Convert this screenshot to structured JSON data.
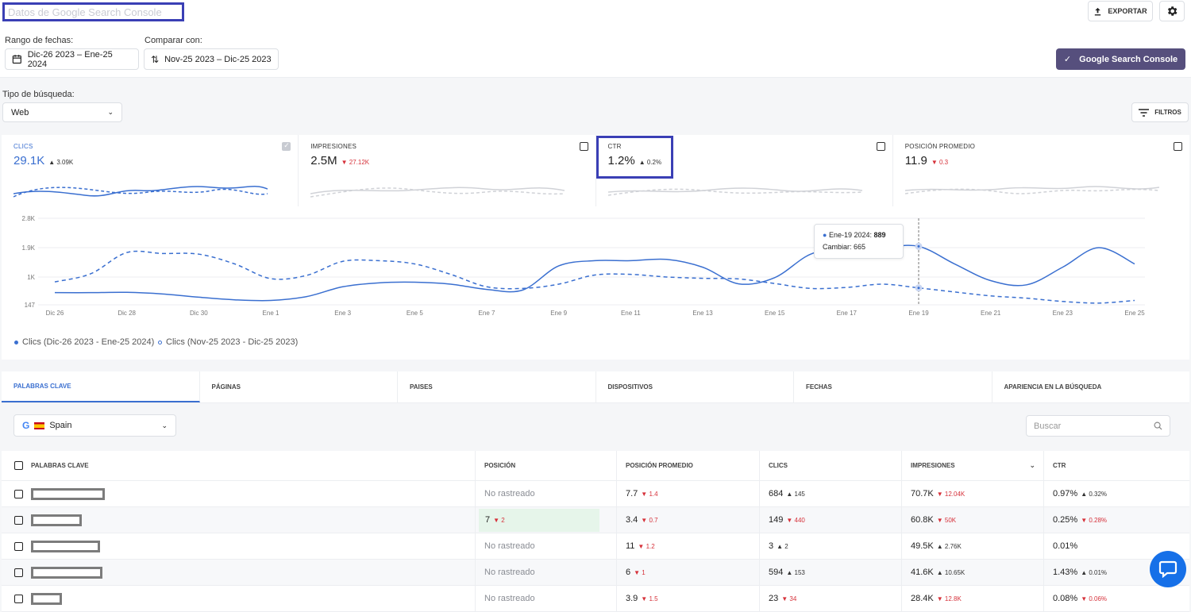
{
  "header": {
    "title": "Datos de Google Search Console",
    "export_label": "EXPORTAR",
    "icons": {
      "export": "upload-icon",
      "settings": "gear-icon"
    }
  },
  "dates": {
    "range_label": "Rango de fechas:",
    "range_value": "Dic-26 2023 – Ene-25 2024",
    "compare_label": "Comparar con:",
    "compare_value": "Nov-25 2023 – Dic-25 2023",
    "gsc_button": "Google Search Console"
  },
  "search_type": {
    "label": "Tipo de búsqueda:",
    "value": "Web",
    "filters_label": "FILTROS"
  },
  "metrics": [
    {
      "name": "CLICS",
      "value": "29.1K",
      "delta": "3.09K",
      "dir": "up",
      "checked": true
    },
    {
      "name": "IMPRESIONES",
      "value": "2.5M",
      "delta": "27.12K",
      "dir": "down",
      "checked": false
    },
    {
      "name": "CTR",
      "value": "1.2%",
      "delta": "0.2%",
      "dir": "up",
      "checked": false
    },
    {
      "name": "POSICIÓN PROMEDIO",
      "value": "11.9",
      "delta": "0.3",
      "dir": "down",
      "checked": false
    }
  ],
  "chart_data": {
    "type": "line",
    "x": [
      "Dic 26",
      "Dic 27",
      "Dic 28",
      "Dic 29",
      "Dic 30",
      "Dic 31",
      "Ene 1",
      "Ene 2",
      "Ene 3",
      "Ene 4",
      "Ene 5",
      "Ene 6",
      "Ene 7",
      "Ene 8",
      "Ene 9",
      "Ene 10",
      "Ene 11",
      "Ene 12",
      "Ene 13",
      "Ene 14",
      "Ene 15",
      "Ene 16",
      "Ene 17",
      "Ene 18",
      "Ene 19",
      "Ene 20",
      "Ene 21",
      "Ene 22",
      "Ene 23",
      "Ene 24",
      "Ene 25"
    ],
    "x_tick_labels": [
      "Dic 26",
      "Dic 28",
      "Dic 30",
      "Ene 1",
      "Ene 3",
      "Ene 5",
      "Ene 7",
      "Ene 9",
      "Ene 11",
      "Ene 13",
      "Ene 15",
      "Ene 17",
      "Ene 19",
      "Ene 21",
      "Ene 23",
      "Ene 25"
    ],
    "y_tick_labels": [
      "2.8K",
      "1.9K",
      "1K",
      "147"
    ],
    "ylim": [
      147,
      2800
    ],
    "series": [
      {
        "name": "Clics (Dic-26 2023 - Ene-25 2024)",
        "style": "solid",
        "values": [
          520,
          520,
          530,
          480,
          380,
          300,
          280,
          400,
          700,
          820,
          840,
          780,
          620,
          600,
          1340,
          1500,
          1500,
          1540,
          1300,
          790,
          980,
          1700,
          1880,
          1900,
          1940,
          1400,
          889,
          760,
          1300,
          1900,
          1400
        ]
      },
      {
        "name": "Clics (Nov-25 2023 - Dic-25 2023)",
        "style": "dashed",
        "values": [
          850,
          1100,
          1750,
          1720,
          1700,
          1400,
          950,
          1050,
          1480,
          1500,
          1400,
          1080,
          700,
          650,
          780,
          1060,
          1080,
          1000,
          960,
          940,
          800,
          650,
          680,
          780,
          665,
          540,
          420,
          350,
          250,
          200,
          280
        ]
      }
    ],
    "tooltip": {
      "label": "Ene-19 2024:",
      "value": "889",
      "compare_label": "Cambiar:",
      "compare_value": "665"
    }
  },
  "tabs": [
    "PALABRAS CLAVE",
    "PÁGINAS",
    "PAISES",
    "DISPOSITIVOS",
    "FECHAS",
    "APARIENCIA EN LA BÚSQUEDA"
  ],
  "country": {
    "value": "Spain"
  },
  "search": {
    "placeholder": "Buscar"
  },
  "table": {
    "headers": [
      "PALABRAS CLAVE",
      "POSICIÓN",
      "POSICIÓN PROMEDIO",
      "CLICS",
      "IMPRESIONES",
      "CTR"
    ],
    "rows": [
      {
        "position": "No rastreado",
        "avg": "7.7",
        "avg_d": "1.4",
        "avg_dir": "down",
        "clics": "684",
        "clics_d": "145",
        "clics_dir": "up",
        "impr": "70.7K",
        "impr_d": "12.04K",
        "impr_dir": "down",
        "ctr": "0.97%",
        "ctr_d": "0.32%",
        "ctr_dir": "up"
      },
      {
        "position": "7",
        "pos_d": "2",
        "avg": "3.4",
        "avg_d": "0.7",
        "avg_dir": "down",
        "clics": "149",
        "clics_d": "440",
        "clics_dir": "down",
        "impr": "60.8K",
        "impr_d": "50K",
        "impr_dir": "down",
        "ctr": "0.25%",
        "ctr_d": "0.28%",
        "ctr_dir": "down"
      },
      {
        "position": "No rastreado",
        "avg": "11",
        "avg_d": "1.2",
        "avg_dir": "down",
        "clics": "3",
        "clics_d": "2",
        "clics_dir": "up",
        "impr": "49.5K",
        "impr_d": "2.76K",
        "impr_dir": "up",
        "ctr": "0.01%",
        "ctr_d": "",
        "ctr_dir": ""
      },
      {
        "position": "No rastreado",
        "avg": "6",
        "avg_d": "1",
        "avg_dir": "down",
        "clics": "594",
        "clics_d": "153",
        "clics_dir": "up",
        "impr": "41.6K",
        "impr_d": "10.65K",
        "impr_dir": "up",
        "ctr": "1.43%",
        "ctr_d": "0.01%",
        "ctr_dir": "up"
      },
      {
        "position": "No rastreado",
        "avg": "3.9",
        "avg_d": "1.5",
        "avg_dir": "down",
        "clics": "23",
        "clics_d": "34",
        "clics_dir": "down",
        "impr": "28.4K",
        "impr_d": "12.8K",
        "impr_dir": "down",
        "ctr": "0.08%",
        "ctr_d": "0.06%",
        "ctr_dir": "down"
      }
    ]
  },
  "colors": {
    "accent": "#3a6fd0",
    "gsc_button": "#564f7d",
    "down": "#d6313a",
    "chat": "#1670e8"
  }
}
